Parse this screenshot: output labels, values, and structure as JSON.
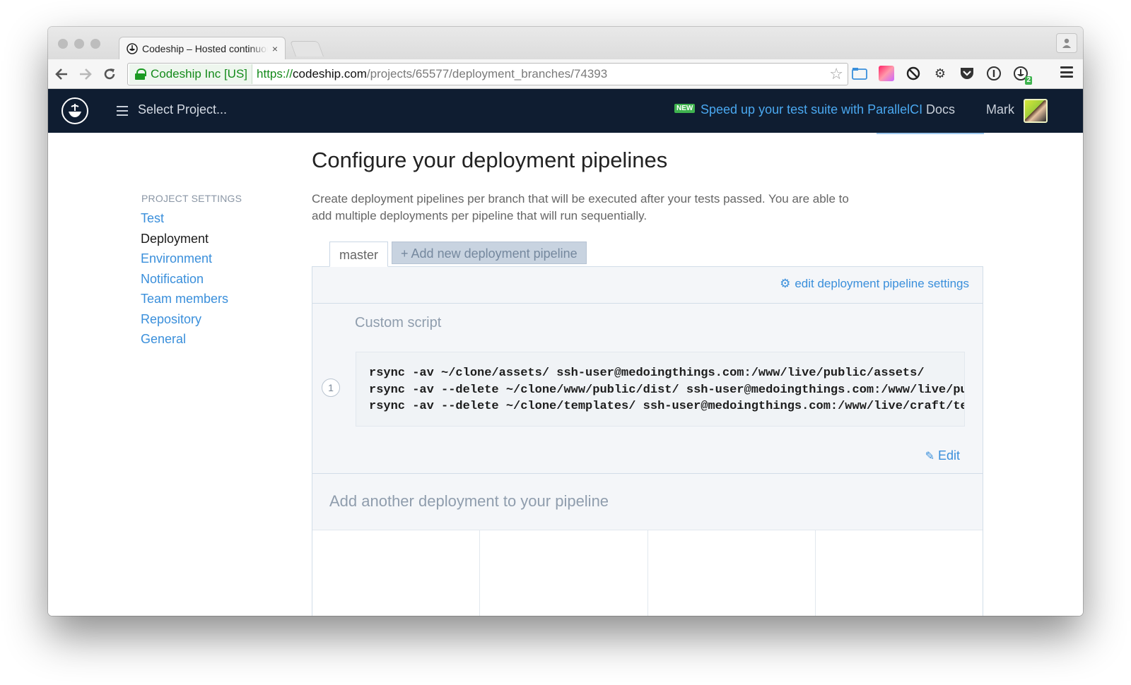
{
  "browser": {
    "tab_title": "Codeship – Hosted continuous deployment",
    "tab_close": "×",
    "ev_label": "Codeship Inc [US]",
    "url_scheme": "https://",
    "url_host": "codeship.com",
    "url_path": "/projects/65577/deployment_branches/74393",
    "extension_badge": "2"
  },
  "header": {
    "select_project": "Select Project...",
    "new_badge": "NEW",
    "promo": "Speed up your test suite with ParallelCI",
    "docs": "Docs",
    "user": "Mark"
  },
  "sidebar": {
    "heading": "PROJECT SETTINGS",
    "items": [
      {
        "label": "Test"
      },
      {
        "label": "Deployment"
      },
      {
        "label": "Environment"
      },
      {
        "label": "Notification"
      },
      {
        "label": "Team members"
      },
      {
        "label": "Repository"
      },
      {
        "label": "General"
      }
    ]
  },
  "main": {
    "title": "Configure your deployment pipelines",
    "intro": "Create deployment pipelines per branch that will be executed after your tests passed. You are able to add multiple deployments per pipeline that will run sequentially.",
    "tabs": {
      "branch": "master",
      "add": "+ Add new deployment pipeline"
    },
    "edit_settings": "edit deployment pipeline settings",
    "deployment": {
      "title": "Custom script",
      "step": "1",
      "lines": [
        "rsync -av ~/clone/assets/ ssh-user@medoingthings.com:/www/live/public/assets/",
        "rsync -av --delete ~/clone/www/public/dist/ ssh-user@medoingthings.com:/www/live/public/dist/",
        "rsync -av --delete ~/clone/templates/ ssh-user@medoingthings.com:/www/live/craft/templates/"
      ],
      "edit": "Edit"
    },
    "add_another": "Add another deployment to your pipeline"
  },
  "colors": {
    "header_bg": "#0f1d31",
    "link": "#3a8fdb",
    "ev_green": "#138a1a"
  }
}
